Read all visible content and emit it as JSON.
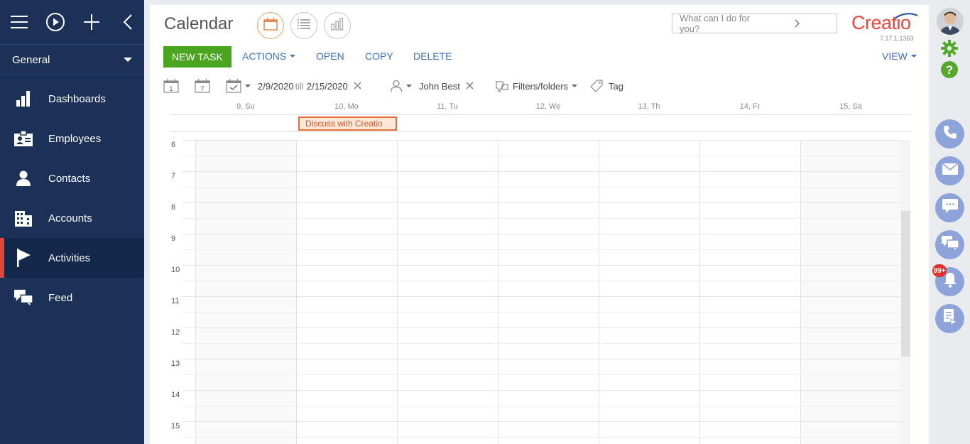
{
  "sidebar": {
    "workspace": "General",
    "items": [
      {
        "label": "Dashboards",
        "icon": "bar-chart-icon"
      },
      {
        "label": "Employees",
        "icon": "badge-icon"
      },
      {
        "label": "Contacts",
        "icon": "person-icon"
      },
      {
        "label": "Accounts",
        "icon": "building-icon"
      },
      {
        "label": "Activities",
        "icon": "flag-icon",
        "active": true
      },
      {
        "label": "Feed",
        "icon": "chat-icon"
      }
    ]
  },
  "header": {
    "title": "Calendar",
    "search_placeholder": "What can I do for you?",
    "logo": "Creatio",
    "version": "7.17.1.1363"
  },
  "toolbar": {
    "new_task": "NEW TASK",
    "actions": "ACTIONS",
    "open": "OPEN",
    "copy": "COPY",
    "delete": "DELETE",
    "view": "VIEW"
  },
  "filters": {
    "day_icon_num": "1",
    "week_icon_num": "7",
    "date_from": "2/9/2020",
    "till": "till",
    "date_to": "2/15/2020",
    "owner": "John Best",
    "filters_folders": "Filters/folders",
    "tag": "Tag"
  },
  "calendar": {
    "days": [
      "9, Su",
      "10, Mo",
      "11, Tu",
      "12, We",
      "13, Th",
      "14, Fr",
      "15, Sa"
    ],
    "event": "Discuss with Creatio",
    "hours": [
      "6",
      "7",
      "8",
      "9",
      "10",
      "11",
      "12",
      "13",
      "14",
      "15"
    ]
  },
  "notifications": {
    "badge": "99+"
  },
  "colors": {
    "sidebar_bg": "#1b3158",
    "accent_red": "#e0483d",
    "new_task_green": "#4aa51e",
    "link_blue": "#3e6fbe",
    "event_orange": "#e56f3a",
    "right_icon_blue": "#8da3da"
  }
}
